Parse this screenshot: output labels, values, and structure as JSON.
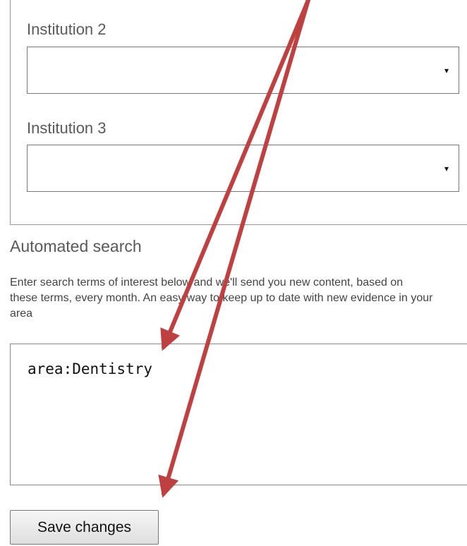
{
  "form": {
    "institution_2": {
      "label": "Institution 2",
      "selected_value": "",
      "arrow": "▾"
    },
    "institution_3": {
      "label": "Institution 3",
      "selected_value": "",
      "arrow": "▾"
    }
  },
  "automated_search": {
    "heading": "Automated search",
    "description": "Enter search terms of interest below and we'll send you new content, based on these terms, every month. An easy way to keep up to date with new evidence in your area",
    "search_terms_value": "area:Dentistry"
  },
  "actions": {
    "save_label": "Save changes"
  },
  "annotations": {
    "arrow_color": "#bf4040",
    "arrow_count": 2
  }
}
